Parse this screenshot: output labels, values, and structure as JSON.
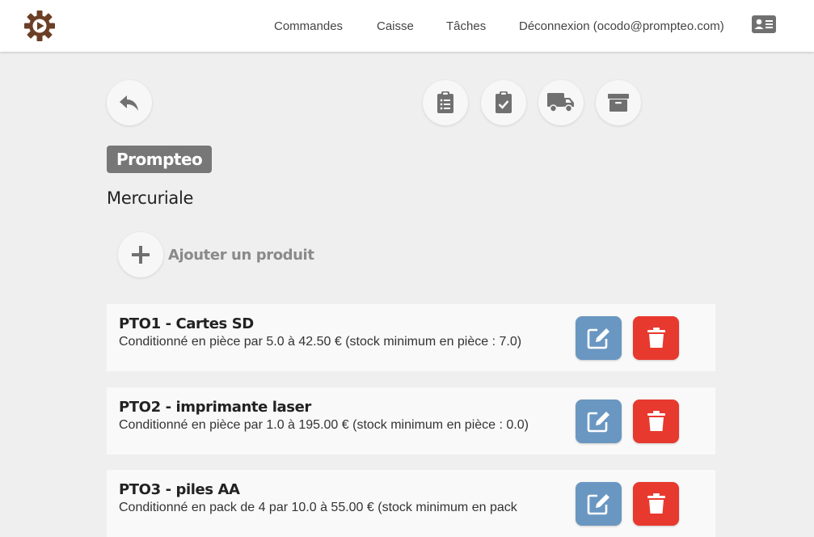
{
  "navbar": {
    "logo_icon": "gear-play-logo-icon",
    "links": [
      "Commandes",
      "Caisse",
      "Tâches",
      "Déconnexion (ocodo@prompteo.com)"
    ],
    "profile_icon": "id-card-icon"
  },
  "toolbar": {
    "back_icon": "reply-arrow-icon",
    "actions": [
      "clipboard-list-icon",
      "clipboard-check-icon",
      "truck-icon",
      "archive-box-icon"
    ]
  },
  "badge": "Prompteo",
  "section_title": "Mercuriale",
  "add_product_label": "Ajouter un produit",
  "products": [
    {
      "title": "PTO1 - Cartes SD",
      "description": "Conditionné en pièce par 5.0 à 42.50 € (stock minimum en pièce : 7.0)"
    },
    {
      "title": "PTO2 - imprimante laser",
      "description": "Conditionné en pièce par 1.0 à 195.00 € (stock minimum en pièce : 0.0)"
    },
    {
      "title": "PTO3 - piles AA",
      "description": "Conditionné en pack de 4 par 10.0 à 55.00 € (stock minimum en pack"
    }
  ],
  "colors": {
    "logo": "#6b3f26",
    "edit_button": "#6a97c1",
    "delete_button": "#e8392f",
    "badge": "#777777",
    "icon_gray": "#707070"
  }
}
